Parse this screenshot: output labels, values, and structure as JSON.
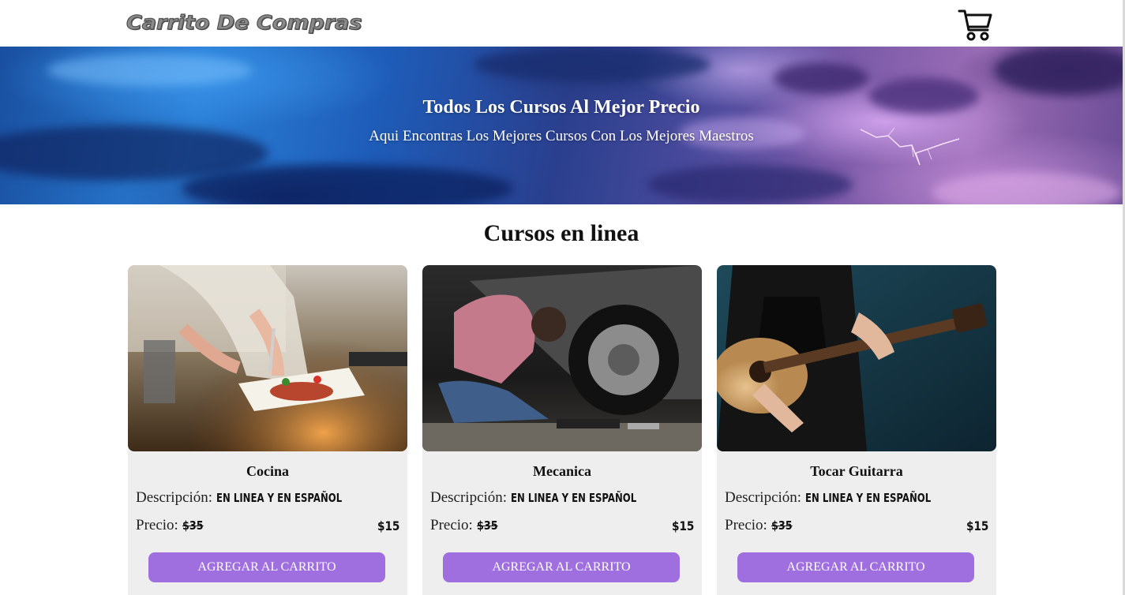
{
  "header": {
    "brand": "Carrito De Compras",
    "cart_icon": "shopping-cart-icon"
  },
  "hero": {
    "title": "Todos Los Cursos Al Mejor Precio",
    "subtitle": "Aqui Encontras Los Mejores Cursos Con Los Mejores Maestros"
  },
  "section": {
    "title": "Cursos en linea"
  },
  "colors": {
    "button": "#9f6fe0",
    "card_bg": "#eeeeee"
  },
  "courses": [
    {
      "title": "Cocina",
      "desc_label": "Descripción:",
      "desc_value": "EN LINEA Y EN ESPAÑOL",
      "price_label": "Precio:",
      "old_price": "$35",
      "new_price": "$15",
      "button": "AGREGAR AL CARRITO",
      "image": "chef-plating-food-photo"
    },
    {
      "title": "Mecanica",
      "desc_label": "Descripción:",
      "desc_value": "EN LINEA Y EN ESPAÑOL",
      "price_label": "Precio:",
      "old_price": "$35",
      "new_price": "$15",
      "button": "AGREGAR AL CARRITO",
      "image": "mechanic-car-wheel-photo"
    },
    {
      "title": "Tocar Guitarra",
      "desc_label": "Descripción:",
      "desc_value": "EN LINEA Y EN ESPAÑOL",
      "price_label": "Precio:",
      "old_price": "$35",
      "new_price": "$15",
      "button": "AGREGAR AL CARRITO",
      "image": "guitar-player-photo"
    }
  ]
}
